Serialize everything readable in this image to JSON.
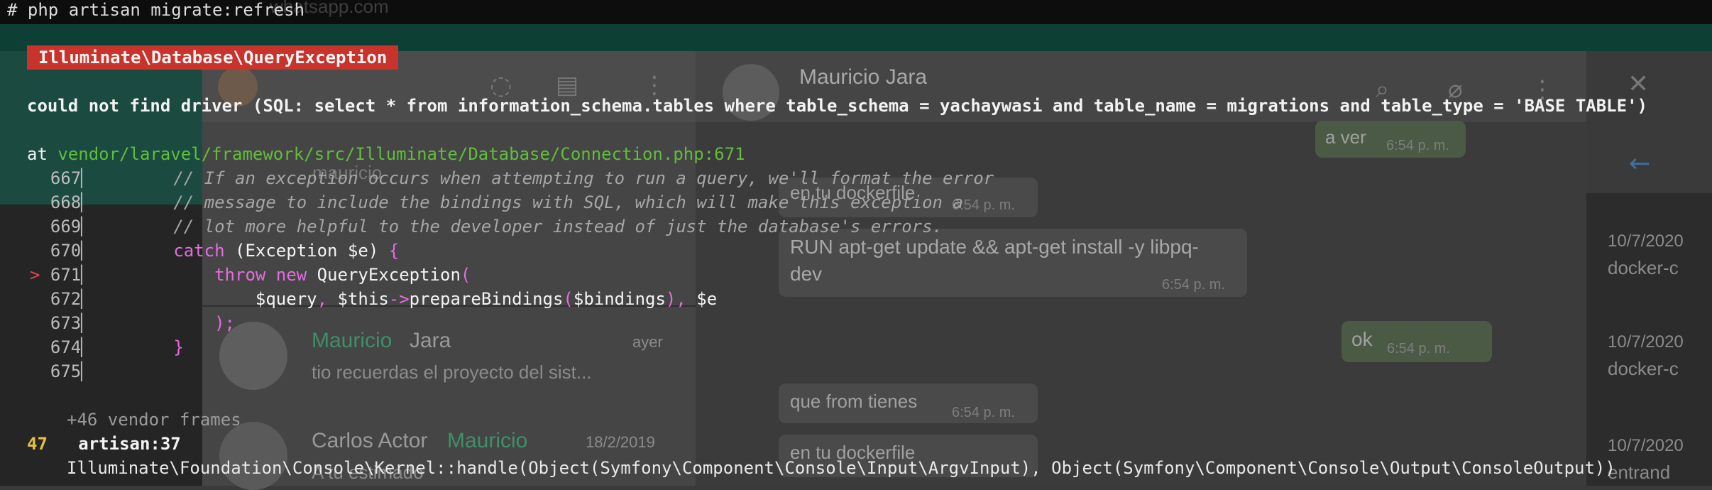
{
  "background": {
    "url_text": "whatsapp.com",
    "chat_header_name": "Mauricio Jara",
    "chat_list": [
      {
        "name_highlight": "Mauricio",
        "name_rest": " Jara",
        "time": "ayer",
        "preview": "tio recuerdas el proyecto del sist..."
      },
      {
        "name_plain": "Carlos Actor ",
        "name_highlight": "Mauricio",
        "time": "18/2/2019",
        "preview": "A tu estimado"
      }
    ],
    "messages": [
      {
        "text": "a ver",
        "time": "6:54 p. m.",
        "outgoing": true
      },
      {
        "text": "en tu dockerfile",
        "time": "6:54 p. m.",
        "outgoing": false
      },
      {
        "text": "RUN apt-get update && apt-get install -y libpq-",
        "text2": "dev",
        "time": "6:54 p. m.",
        "outgoing": false
      },
      {
        "text": "ok",
        "time": "6:54 p. m.",
        "outgoing": true
      },
      {
        "text": "que from tienes",
        "time": "6:54 p. m.",
        "outgoing": false
      },
      {
        "text": "en tu dockerfile",
        "time": "",
        "outgoing": false
      }
    ],
    "right_panel": {
      "dates": [
        "10/7/2020",
        "10/7/2020",
        "10/7/2020"
      ],
      "snippets": [
        "docker-c",
        "docker-c",
        "entrand"
      ]
    },
    "misc_text": "mauricio"
  },
  "terminal": {
    "command": "# php artisan migrate:refresh",
    "exception_class": "Illuminate\\Database\\QueryException",
    "message": "could not find driver (SQL: select * from information_schema.tables where table_schema = yachaywasi and table_name = migrations and table_type = 'BASE TABLE')",
    "at_prefix": "at ",
    "at_path": "vendor/laravel/framework/src/Illuminate/Database/Connection.php",
    "at_line": ":671",
    "code_lines": [
      {
        "num": "667",
        "text": "        // If an exception occurs when attempting to run a query, we'll format the error"
      },
      {
        "num": "668",
        "text": "        // message to include the bindings with SQL, which will make this exception a"
      },
      {
        "num": "669",
        "text": "        // lot more helpful to the developer instead of just the database's errors."
      },
      {
        "num": "670",
        "text": "        catch (Exception $e) {"
      },
      {
        "num": "671",
        "text": "            throw new QueryException("
      },
      {
        "num": "672",
        "text": "                $query, $this->prepareBindings($bindings), $e"
      },
      {
        "num": "673",
        "text": "            );"
      },
      {
        "num": "674",
        "text": "        }"
      },
      {
        "num": "675",
        "text": ""
      }
    ],
    "highlight_marker": ">",
    "vendor_frames": "+46 vendor frames",
    "frame_number": "47",
    "frame_location": "artisan:37",
    "frame_call": "Illuminate\\Foundation\\Console\\Kernel::handle(Object(Symfony\\Component\\Console\\Input\\ArgvInput), Object(Symfony\\Component\\Console\\Output\\ConsoleOutput))"
  }
}
